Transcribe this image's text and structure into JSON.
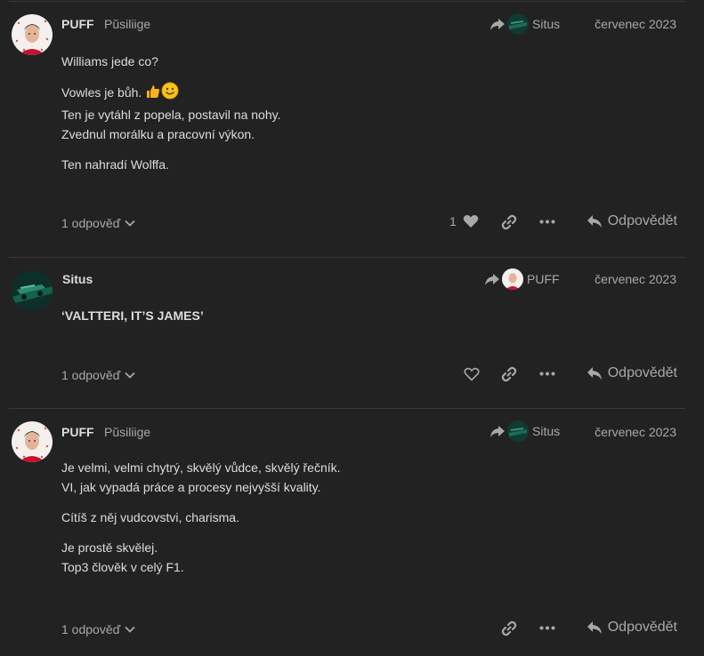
{
  "posts": [
    {
      "username": "PUFF",
      "user_title": "Pŭsiliige",
      "reply_to": "Situs",
      "date": "červenec 2023",
      "body": [
        "Williams jede co?"
      ],
      "body2": [
        "Vowles je bůh. ",
        "Ten je vytáhl z popela, postavil na nohy.",
        "Zvednul morálku a pracovní výkon."
      ],
      "body3": [
        "Ten nahradí Wolffa."
      ],
      "replies_label": "1 odpověď",
      "like_count": "1",
      "reply_label": "Odpovědět"
    },
    {
      "username": "Situs",
      "reply_to": "PUFF",
      "date": "červenec 2023",
      "body": [
        "‘VALTTERI, IT’S JAMES’"
      ],
      "replies_label": "1 odpověď",
      "reply_label": "Odpovědět"
    },
    {
      "username": "PUFF",
      "user_title": "Pŭsiliige",
      "reply_to": "Situs",
      "date": "červenec 2023",
      "body": [
        "Je velmi, velmi chytrý, skvělý vůdce, skvělý řečník.",
        "VI, jak vypadá práce a procesy nejvyšší kvality."
      ],
      "body2": [
        "Cítíš z něj vudcovstvi, charisma."
      ],
      "body3": [
        "Je prostě skvělej.",
        "Top3 člověk v celý F1."
      ],
      "replies_label": "1 odpověď",
      "reply_label": "Odpovědět"
    }
  ],
  "colors": {
    "background": "#222222",
    "text": "#dddddd",
    "muted": "#a8a8a8",
    "divider": "#3a3a3a"
  },
  "icons": [
    "share-icon",
    "heart-icon",
    "link-icon",
    "ellipsis-icon",
    "reply-icon",
    "chevron-down-icon"
  ]
}
